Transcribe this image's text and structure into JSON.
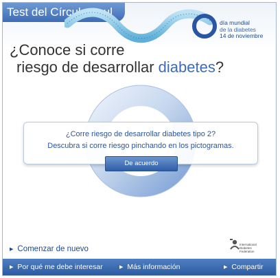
{
  "header": {
    "title": "Test del Círculo Azul",
    "event_line1": "día mundial",
    "event_line2": "de la diabetes",
    "event_line3": "14 de noviembre"
  },
  "question": {
    "line1": "¿Conoce si corre",
    "line2_prefix": "riesgo de desarrollar ",
    "line2_accent": "diabetes",
    "line2_suffix": "?"
  },
  "dialog": {
    "line1": "¿Corre riesgo de desarrollar diabetes tipo 2?",
    "line2": "Descubra si corre riesgo pinchando en los pictogramas.",
    "button_label": "De acuerdo"
  },
  "restart_label": "Comenzar de nuevo",
  "logo": {
    "line1": "International",
    "line2": "Diabetes",
    "line3": "Federation"
  },
  "bottom_bar": {
    "link1": "Por qué me debe interesar",
    "link2": "Más información",
    "link3": "Compartir"
  },
  "colors": {
    "brand_blue": "#3d6cb5",
    "dark_blue": "#1e4a92",
    "ring_light": "#c9d8ee"
  },
  "icons": {
    "tape": "measuring-tape-icon",
    "ring": "blue-circle-logo-icon",
    "idf": "idf-logo-icon",
    "arrow": "triangle-right-icon"
  }
}
